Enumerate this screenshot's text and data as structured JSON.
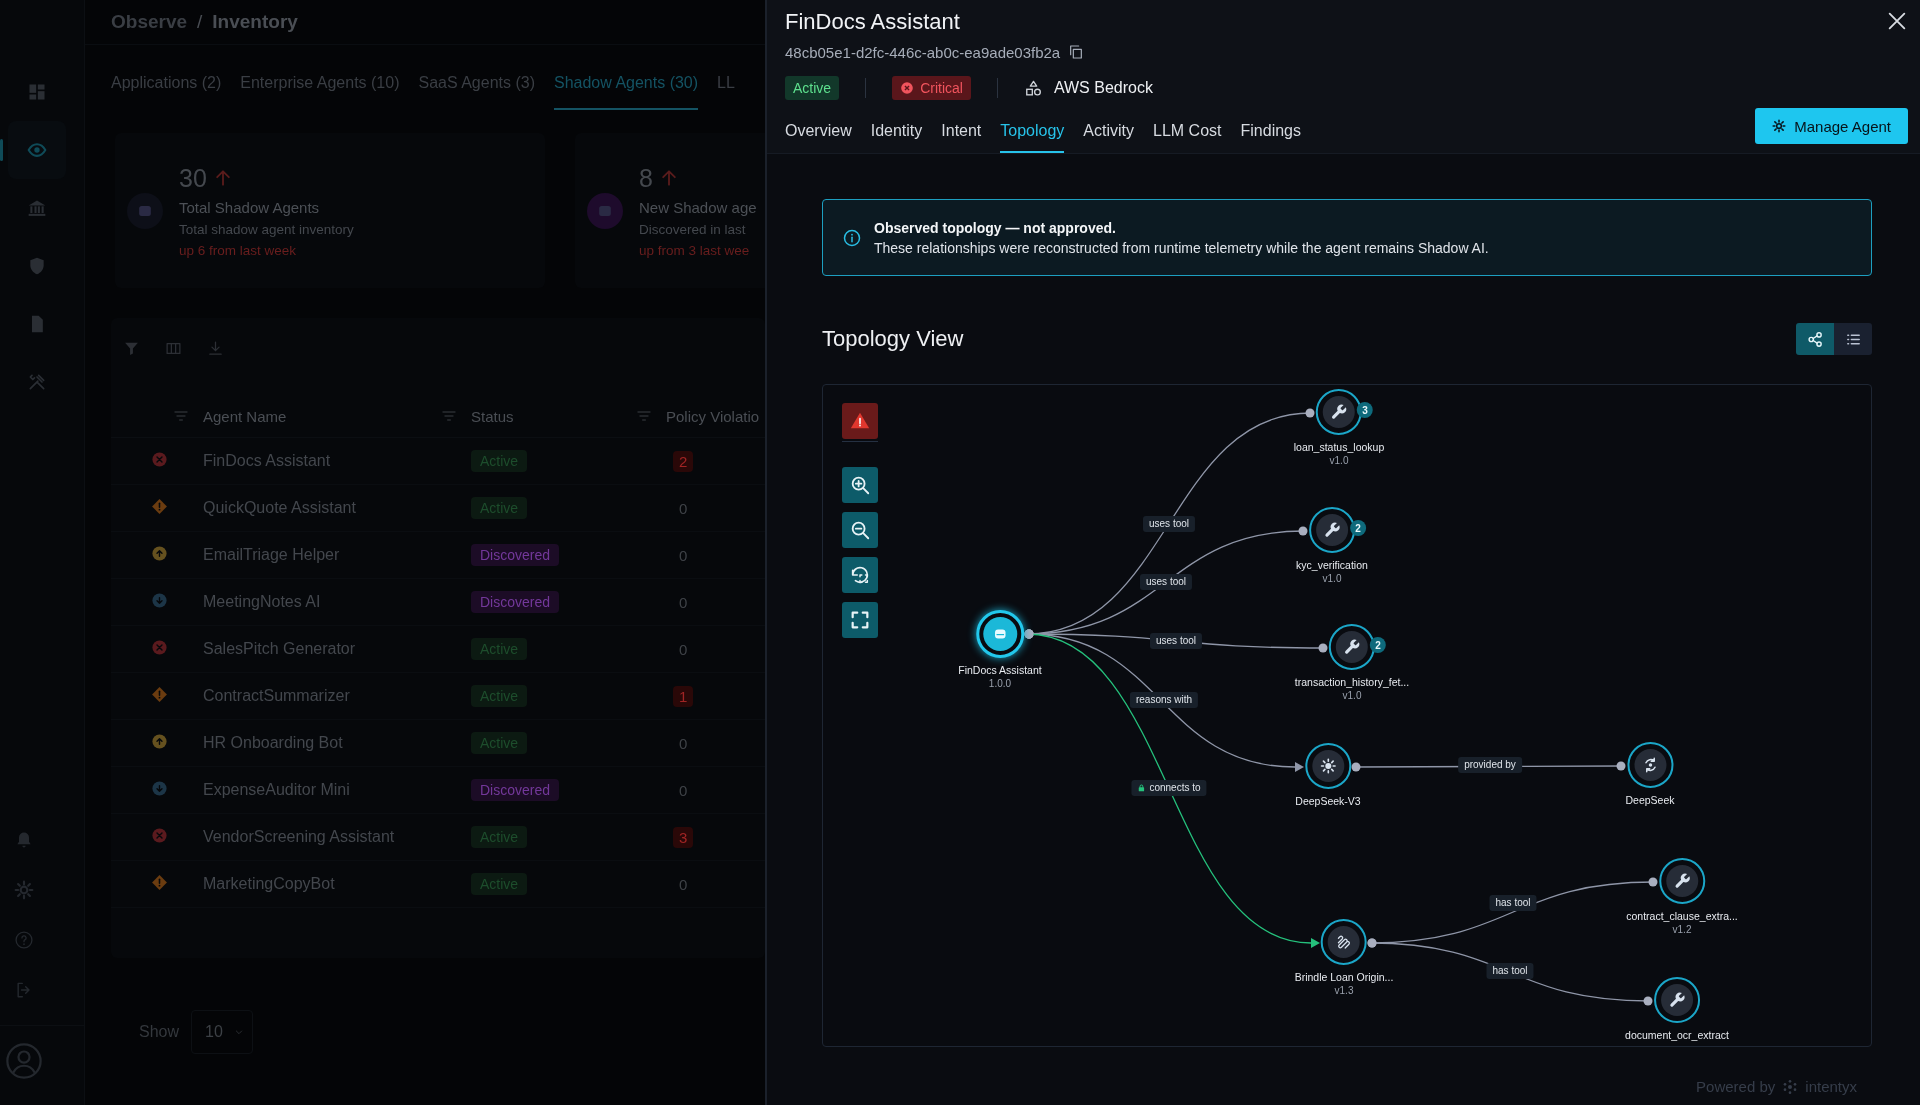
{
  "sidebar": {
    "top_items": [
      {
        "kind": "dashboard",
        "selected": false
      },
      {
        "kind": "observe",
        "selected": true
      },
      {
        "kind": "bank",
        "selected": false
      },
      {
        "kind": "shield",
        "selected": false
      },
      {
        "kind": "document",
        "selected": false
      },
      {
        "kind": "tools",
        "selected": false
      }
    ],
    "bottom_items": [
      {
        "kind": "bell"
      },
      {
        "kind": "settings"
      },
      {
        "kind": "help"
      },
      {
        "kind": "logout"
      },
      {
        "kind": "profile"
      }
    ]
  },
  "breadcrumb": {
    "parent": "Observe",
    "separator": "/",
    "current": "Inventory"
  },
  "inventory_tabs": [
    {
      "label": "Applications (2)",
      "selected": false
    },
    {
      "label": "Enterprise Agents (10)",
      "selected": false
    },
    {
      "label": "SaaS Agents (3)",
      "selected": false
    },
    {
      "label": "Shadow Agents (30)",
      "selected": true
    },
    {
      "label": "LL",
      "selected": false
    }
  ],
  "summary_cards": [
    {
      "value": "30",
      "title": "Total Shadow Agents",
      "subtitle": "Total shadow agent inventory",
      "trend": "up 6 from last week",
      "color": "#0d0f18"
    },
    {
      "value": "8",
      "title": "New Shadow age",
      "subtitle": "Discovered in last",
      "trend": "up from 3 last wee",
      "color": "#1e0b2c"
    }
  ],
  "table": {
    "columns": [
      "Agent Name",
      "Status",
      "Policy Violatio"
    ],
    "rows": [
      {
        "kind": "critical",
        "name": "FinDocs Assistant",
        "status": {
          "label": "Active",
          "kind": "active"
        },
        "violations": "2",
        "flagged": true
      },
      {
        "kind": "high",
        "name": "QuickQuote Assistant",
        "status": {
          "label": "Active",
          "kind": "active"
        },
        "violations": "0",
        "flagged": false
      },
      {
        "kind": "medium",
        "name": "EmailTriage Helper",
        "status": {
          "label": "Discovered",
          "kind": "discovered"
        },
        "violations": "0",
        "flagged": false
      },
      {
        "kind": "low",
        "name": "MeetingNotes AI",
        "status": {
          "label": "Discovered",
          "kind": "discovered"
        },
        "violations": "0",
        "flagged": false
      },
      {
        "kind": "critical",
        "name": "SalesPitch Generator",
        "status": {
          "label": "Active",
          "kind": "active"
        },
        "violations": "0",
        "flagged": false
      },
      {
        "kind": "high",
        "name": "ContractSummarizer",
        "status": {
          "label": "Active",
          "kind": "active"
        },
        "violations": "1",
        "flagged": true
      },
      {
        "kind": "medium",
        "name": "HR Onboarding Bot",
        "status": {
          "label": "Active",
          "kind": "active"
        },
        "violations": "0",
        "flagged": false
      },
      {
        "kind": "low",
        "name": "ExpenseAuditor Mini",
        "status": {
          "label": "Discovered",
          "kind": "discovered"
        },
        "violations": "0",
        "flagged": false
      },
      {
        "kind": "critical",
        "name": "VendorScreening Assistant",
        "status": {
          "label": "Active",
          "kind": "active"
        },
        "violations": "3",
        "flagged": true
      },
      {
        "kind": "high",
        "name": "MarketingCopyBot",
        "status": {
          "label": "Active",
          "kind": "active"
        },
        "violations": "0",
        "flagged": false
      }
    ]
  },
  "page_size": {
    "label": "Show",
    "value": "10"
  },
  "drawer": {
    "title": "FinDocs Assistant",
    "id": "48cb05e1-d2fc-446c-ab0c-ea9ade03fb2a",
    "status": "Active",
    "risk": "Critical",
    "platform": "AWS Bedrock",
    "tabs": [
      {
        "label": "Overview",
        "selected": false
      },
      {
        "label": "Identity",
        "selected": false
      },
      {
        "label": "Intent",
        "selected": false
      },
      {
        "label": "Topology",
        "selected": true
      },
      {
        "label": "Activity",
        "selected": false
      },
      {
        "label": "LLM Cost",
        "selected": false
      },
      {
        "label": "Findings",
        "selected": false
      }
    ],
    "action": "Manage Agent",
    "notice": {
      "title": "Observed topology — not approved.",
      "text": "These relationships were reconstructed from runtime telemetry while the agent remains Shadow AI."
    },
    "section_title": "Topology View",
    "view_toggle": [
      {
        "kind": "graph",
        "selected": true
      },
      {
        "kind": "list",
        "selected": false
      }
    ],
    "graph_controls": [
      {
        "kind": "alert"
      },
      {
        "kind": "zoom_in"
      },
      {
        "kind": "zoom_out"
      },
      {
        "kind": "reset"
      },
      {
        "kind": "fit"
      }
    ],
    "graph": {
      "nodes": [
        {
          "kind": "agent",
          "label": "FinDocs Assistant",
          "version": "1.0.0"
        },
        {
          "kind": "tool",
          "label": "loan_status_lookup",
          "version": "v1.0",
          "badge": "3"
        },
        {
          "kind": "tool",
          "label": "kyc_verification",
          "version": "v1.0",
          "badge": "2"
        },
        {
          "kind": "tool",
          "label": "transaction_history_fet...",
          "version": "v1.0",
          "badge": "2"
        },
        {
          "kind": "model",
          "label": "DeepSeek-V3"
        },
        {
          "kind": "provider",
          "label": "DeepSeek"
        },
        {
          "kind": "app",
          "label": "Brindle Loan Origin...",
          "version": "v1.3"
        },
        {
          "kind": "tool",
          "label": "contract_clause_extra...",
          "version": "v1.2"
        },
        {
          "kind": "tool",
          "label": "document_ocr_extract"
        }
      ],
      "edges": [
        {
          "kind": "tool",
          "label": "uses tool"
        },
        {
          "kind": "tool",
          "label": "uses tool"
        },
        {
          "kind": "tool",
          "label": "uses tool"
        },
        {
          "kind": "model",
          "label": "reasons with"
        },
        {
          "kind": "secure",
          "label": "connects to"
        },
        {
          "kind": "provider",
          "label": "provided by"
        },
        {
          "kind": "tool",
          "label": "has tool"
        },
        {
          "kind": "tool",
          "label": "has tool"
        }
      ]
    },
    "footer": {
      "prefix": "Powered by",
      "brand": "intentyx"
    }
  }
}
